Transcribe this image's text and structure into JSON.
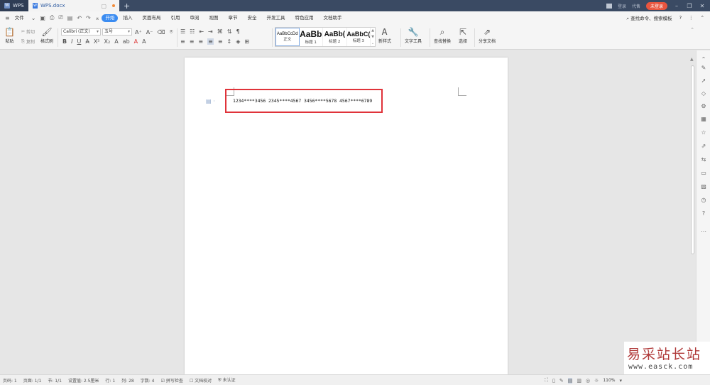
{
  "titlebar": {
    "app_tab": "WPS",
    "doc_tab": "WPS.docx",
    "new_tab": "+",
    "right_items": [
      "登录",
      "代售"
    ],
    "login_button": "未登录"
  },
  "menubar": {
    "file": "文件",
    "tabs": [
      "开始",
      "插入",
      "页面布局",
      "引用",
      "审阅",
      "视图",
      "章节",
      "安全",
      "开发工具",
      "特色应用",
      "文档助手"
    ],
    "search": "查找命令、搜索模板",
    "help": "?"
  },
  "ribbon": {
    "paste": "粘贴",
    "cut": "剪切",
    "copy": "复制",
    "format_painter": "格式刷",
    "font_name": "Calibri (正文)",
    "font_size": "五号",
    "styles": [
      {
        "sample": "AaBbCcDd",
        "name": "正文"
      },
      {
        "sample": "AaBb",
        "name": "标题 1"
      },
      {
        "sample": "AaBb(",
        "name": "标题 2"
      },
      {
        "sample": "AaBbC(",
        "name": "标题 3"
      }
    ],
    "new_style": "新样式",
    "text_tools": "文字工具",
    "find_replace": "查找替换",
    "select": "选择",
    "share_doc": "分享文档"
  },
  "document": {
    "text": "1234****3456 2345****4567 3456****5678 4567****6789"
  },
  "watermark": {
    "line1": "易采站长站",
    "line2": "www.easck.com"
  },
  "statusbar": {
    "items": [
      "页码: 1",
      "页面: 1/1",
      "节: 1/1",
      "设置值: 2.5厘米",
      "行: 1",
      "列: 28",
      "字数: 4",
      "拼写检查",
      "文档校对",
      "未认证"
    ],
    "zoom": "110%"
  }
}
